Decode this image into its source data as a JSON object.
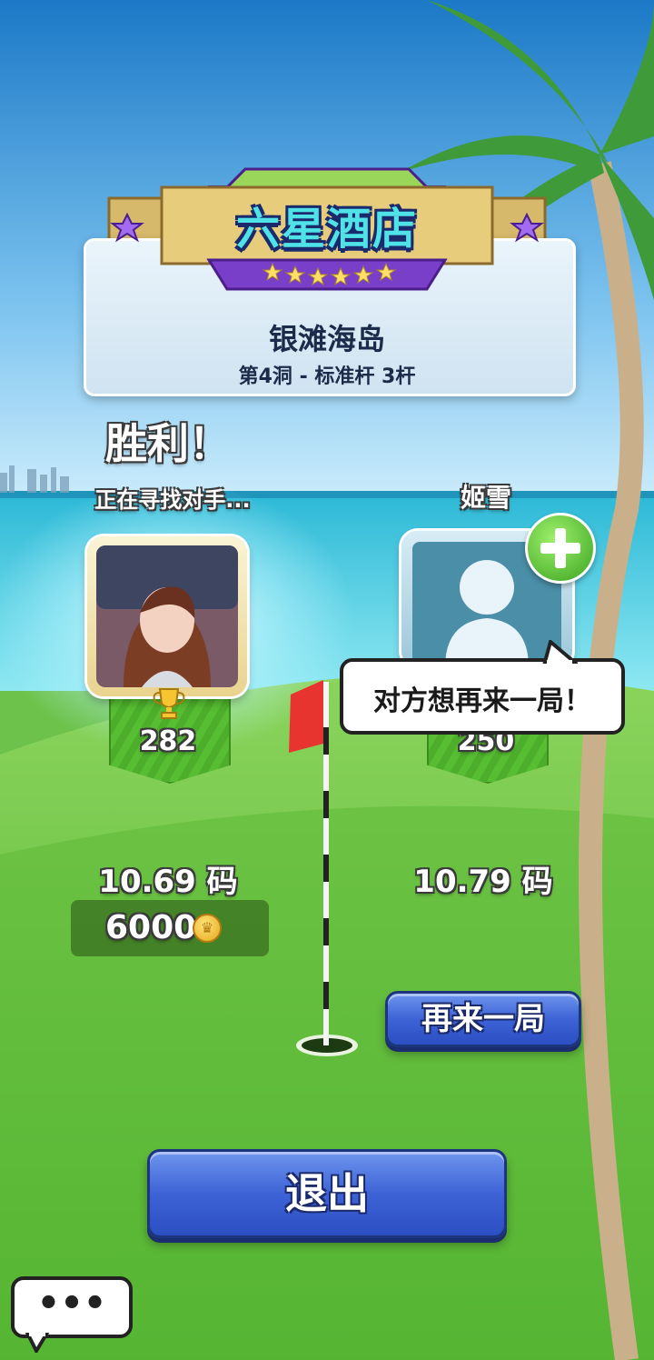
{
  "header": {
    "course_title": "六星酒店",
    "course_name": "银滩海岛",
    "hole_info": "第4洞 - 标准杆 3杆"
  },
  "player1": {
    "result": "胜利！",
    "status": "正在寻找对手...",
    "trophies": "282",
    "distance": "10.69 码",
    "reward": "6000"
  },
  "player2": {
    "name": "姬雪",
    "trophies": "250",
    "distance": "10.79 码"
  },
  "speech": {
    "text": "对方想再来一局！"
  },
  "buttons": {
    "rematch": "再来一局",
    "exit": "退出",
    "chat": "•••"
  },
  "icons": {
    "trophy": "trophy-icon",
    "coin": "coin-icon",
    "add_friend": "plus-icon",
    "chat": "chat-bubble-icon",
    "flag": "golf-flag-icon"
  },
  "colors": {
    "button_blue": "#3d63d6",
    "grass_green": "#6cc24a",
    "banner_purple": "#7a3fc9",
    "title_cyan": "#4fe3e8"
  }
}
